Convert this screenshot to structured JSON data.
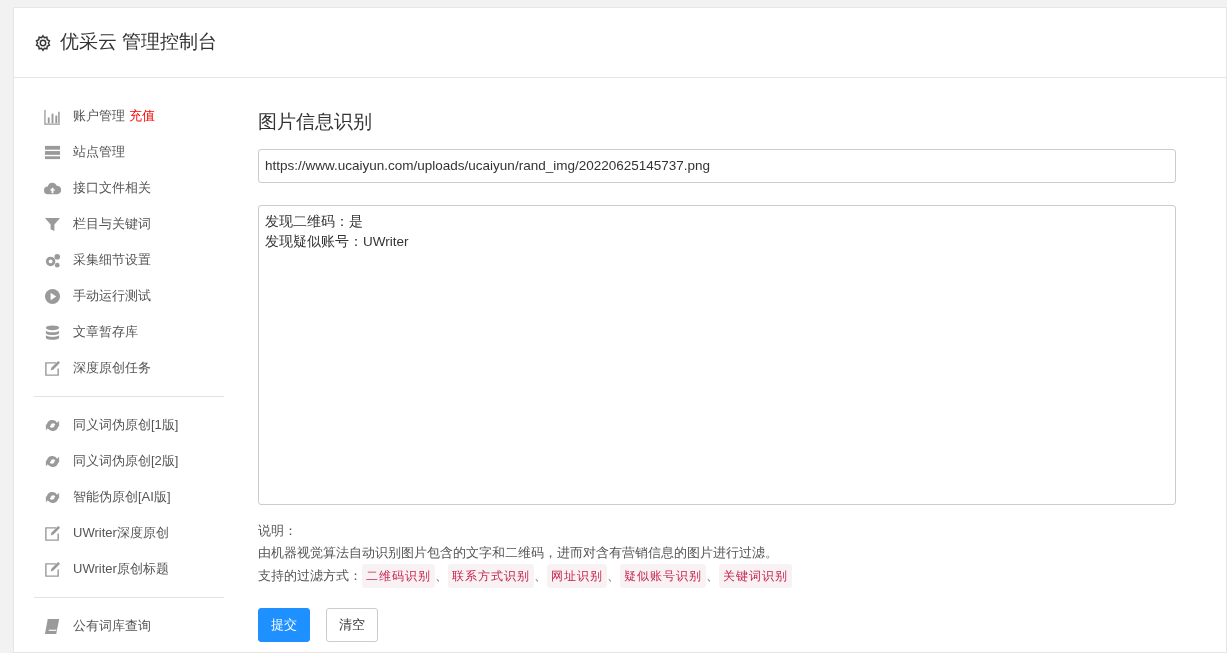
{
  "header": {
    "title": "优采云 管理控制台"
  },
  "sidebar": {
    "groups": [
      {
        "items": [
          {
            "label": "账户管理",
            "badge": "充值"
          },
          {
            "label": "站点管理"
          },
          {
            "label": "接口文件相关"
          },
          {
            "label": "栏目与关键词"
          },
          {
            "label": "采集细节设置"
          },
          {
            "label": "手动运行测试"
          },
          {
            "label": "文章暂存库"
          },
          {
            "label": "深度原创任务"
          }
        ]
      },
      {
        "items": [
          {
            "label": "同义词伪原创[1版]"
          },
          {
            "label": "同义词伪原创[2版]"
          },
          {
            "label": "智能伪原创[AI版]"
          },
          {
            "label": "UWriter深度原创"
          },
          {
            "label": "UWriter原创标题"
          }
        ]
      },
      {
        "items": [
          {
            "label": "公有词库查询"
          }
        ]
      }
    ]
  },
  "main": {
    "title": "图片信息识别",
    "url_field": {
      "value": "https://www.ucaiyun.com/uploads/ucaiyun/rand_img/20220625145737.png"
    },
    "result_box": {
      "lines": [
        "发现二维码：是",
        "发现疑似账号：UWriter"
      ]
    },
    "note_label": "说明：",
    "note_text": "由机器视觉算法自动识别图片包含的文字和二维码，进而对含有营销信息的图片进行过滤。",
    "filters_label": "支持的过滤方式：",
    "filters": [
      {
        "label": "二维码识别",
        "separator": "、"
      },
      {
        "label": "联系方式识别",
        "separator": "、"
      },
      {
        "label": "网址识别",
        "separator": "、"
      },
      {
        "label": "疑似账号识别",
        "separator": "、"
      },
      {
        "label": "关键词识别"
      }
    ],
    "buttons": [
      {
        "label": "提交",
        "kind": "primary"
      },
      {
        "label": "清空",
        "kind": "secondary"
      }
    ]
  }
}
